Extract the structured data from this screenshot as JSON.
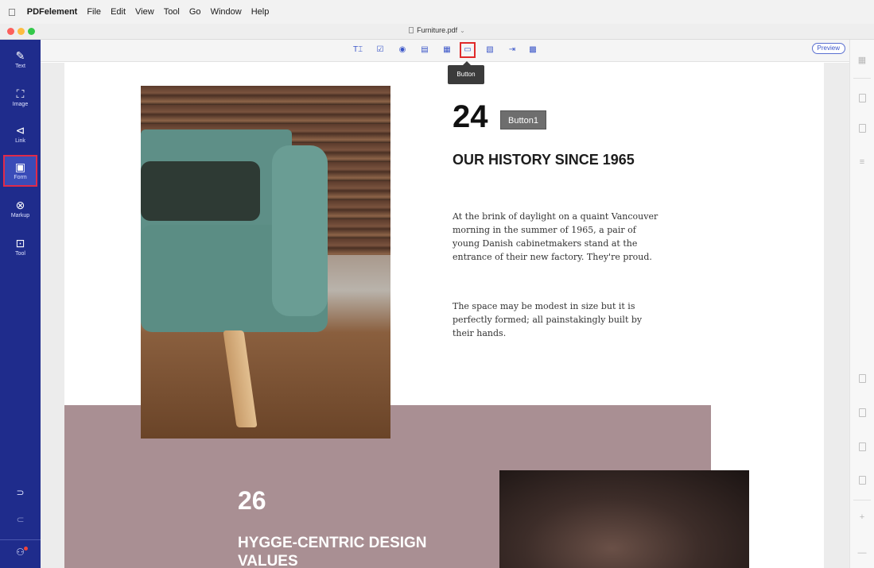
{
  "menubar": {
    "apple_icon": "apple-icon",
    "items": [
      "PDFelement",
      "File",
      "Edit",
      "View",
      "Tool",
      "Go",
      "Window",
      "Help"
    ]
  },
  "window": {
    "title": "Furniture.pdf",
    "chevron": "⌄"
  },
  "left_sidebar": {
    "items": [
      {
        "label": "Text",
        "icon": "✎",
        "icon_name": "pen-icon"
      },
      {
        "label": "Image",
        "icon": "⛶",
        "icon_name": "image-icon"
      },
      {
        "label": "Link",
        "icon": "⊲",
        "icon_name": "link-icon"
      },
      {
        "label": "Form",
        "icon": "▣",
        "icon_name": "form-icon"
      },
      {
        "label": "Markup",
        "icon": "⊗",
        "icon_name": "markup-icon"
      },
      {
        "label": "Tool",
        "icon": "⊡",
        "icon_name": "tool-icon"
      }
    ],
    "undo_icon": "⊃",
    "redo_icon": "⊂",
    "user_icon": "⚇"
  },
  "toolbar": {
    "tools": [
      {
        "name": "text-field-tool",
        "glyph": "T⌶"
      },
      {
        "name": "checkbox-tool",
        "glyph": "☑"
      },
      {
        "name": "radio-button-tool",
        "glyph": "◉"
      },
      {
        "name": "combo-box-tool",
        "glyph": "▤"
      },
      {
        "name": "list-box-tool",
        "glyph": "▦"
      },
      {
        "name": "button-tool",
        "glyph": "▭"
      },
      {
        "name": "image-field-tool",
        "glyph": "▧"
      },
      {
        "name": "signature-tool",
        "glyph": "⇥"
      },
      {
        "name": "barcode-tool",
        "glyph": "▩"
      }
    ],
    "preview_label": "Preview"
  },
  "tooltip": {
    "text": "Button"
  },
  "page": {
    "number_top": "24",
    "form_button_label": "Button1",
    "history_title": "OUR HISTORY SINCE 1965",
    "para1": "At the brink of daylight on a quaint Vancouver morning in the summer of 1965, a pair of young Danish cabinetmakers stand at the entrance of their new factory. They're proud.",
    "para2": "The space may be modest in size but it is perfectly formed; all painstakingly built by their hands.",
    "number_bottom": "26",
    "hygge_title": "HYGGE-CENTRIC DESIGN VALUES"
  },
  "right_sidebar": {
    "icons": [
      "thumbnails-icon",
      "page-icon",
      "bookmark-icon",
      "outline-icon",
      "form-data-icon",
      "import-icon",
      "export-icon",
      "clear-icon",
      "zoom-in-icon",
      "zoom-out-icon"
    ],
    "zoom_in_glyph": "+",
    "zoom_out_glyph": "—"
  },
  "colors": {
    "sidebar_blue": "#1f2c8c",
    "accent_blue": "#3a55c8",
    "highlight_red": "#e02a4a",
    "mauve": "#a98f93"
  }
}
